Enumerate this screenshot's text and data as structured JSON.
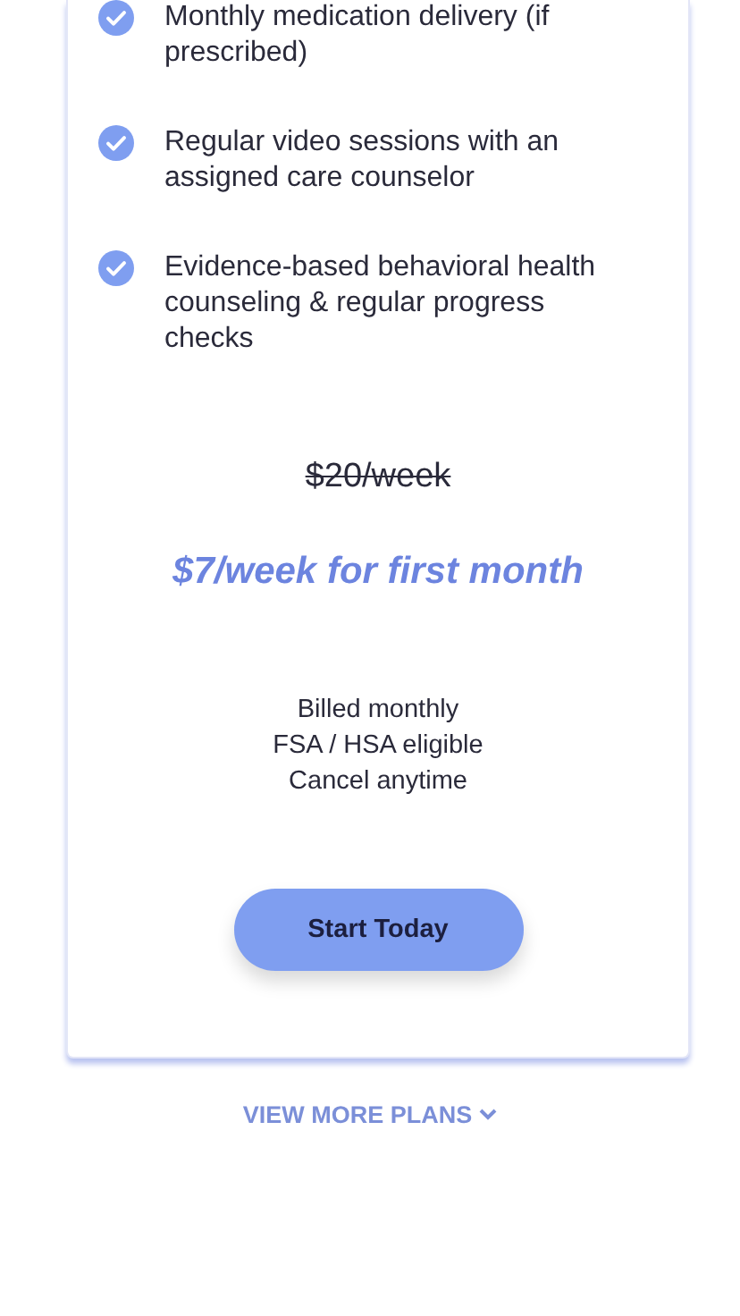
{
  "features": [
    {
      "text": "Monthly medication delivery (if prescribed)"
    },
    {
      "text": "Regular video sessions with an assigned care counselor"
    },
    {
      "text": "Evidence-based behavioral health counseling & regular progress checks"
    }
  ],
  "pricing": {
    "original_price": "$20/week",
    "promo_price": "$7/week for first month",
    "notes": [
      "Billed monthly",
      "FSA / HSA eligible",
      "Cancel anytime"
    ]
  },
  "cta_button": "Start Today",
  "more_plans_link": "VIEW MORE PLANS"
}
